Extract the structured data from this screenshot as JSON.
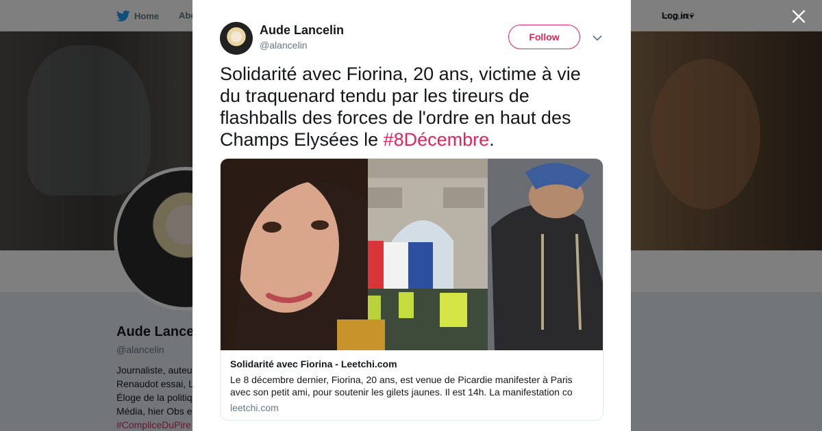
{
  "nav": {
    "home": "Home",
    "about": "Abo",
    "account": "ccount?",
    "login": "Log in"
  },
  "profile": {
    "name": "Aude Lance",
    "handle": "@alancelin",
    "bio": [
      "Journaliste, auteu",
      "Renaudot essai, L",
      "Éloge de la politiq",
      "Média, hier Obs e"
    ],
    "bio_tag": "#CompliceDuPire"
  },
  "tweet": {
    "author_name": "Aude Lancelin",
    "author_handle": "@alancelin",
    "follow_label": "Follow",
    "text": "Solidarité avec Fiorina, 20 ans, victime à vie du traquenard tendu par les tireurs de flashballs des forces de l'ordre en haut des Champs Elysées le ",
    "hashtag": "#8Décembre",
    "text_end": "."
  },
  "card": {
    "title": "Solidarité avec Fiorina - Leetchi.com",
    "description": "Le 8 décembre dernier, Fiorina, 20 ans, est venue de Picardie manifester à Paris avec son petit ami, pour soutenir les gilets jaunes. Il est 14h. La manifestation co",
    "domain": "leetchi.com"
  },
  "colors": {
    "accent": "#e0245e",
    "text": "#14171a",
    "secondary": "#657786",
    "twitter_blue": "#1da1f2"
  }
}
